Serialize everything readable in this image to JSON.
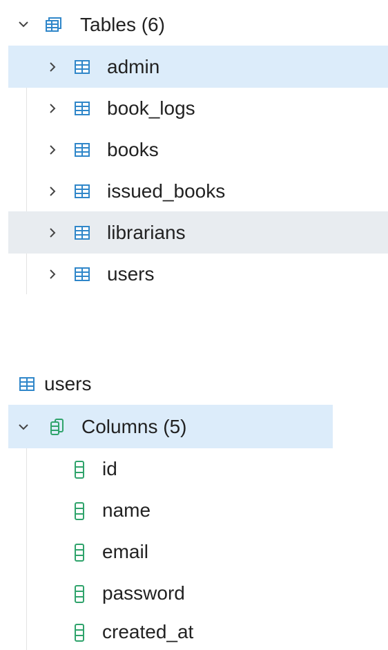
{
  "tree_top": {
    "tables_group": {
      "label": "Tables (6)",
      "expanded": true
    },
    "tables": [
      {
        "name": "admin",
        "state": "selected"
      },
      {
        "name": "book_logs",
        "state": "normal"
      },
      {
        "name": "books",
        "state": "normal"
      },
      {
        "name": "issued_books",
        "state": "normal"
      },
      {
        "name": "librarians",
        "state": "hover"
      },
      {
        "name": "users",
        "state": "normal"
      }
    ]
  },
  "tree_bottom": {
    "table_label": "users",
    "columns_group": {
      "label": "Columns (5)",
      "expanded": true
    },
    "columns": [
      "id",
      "name",
      "email",
      "password",
      "created_at"
    ]
  },
  "colors": {
    "selected_bg": "#dcecfa",
    "hover_bg": "#e8ecf0",
    "table_icon": "#2f86c9",
    "column_icon": "#2fa36b"
  }
}
